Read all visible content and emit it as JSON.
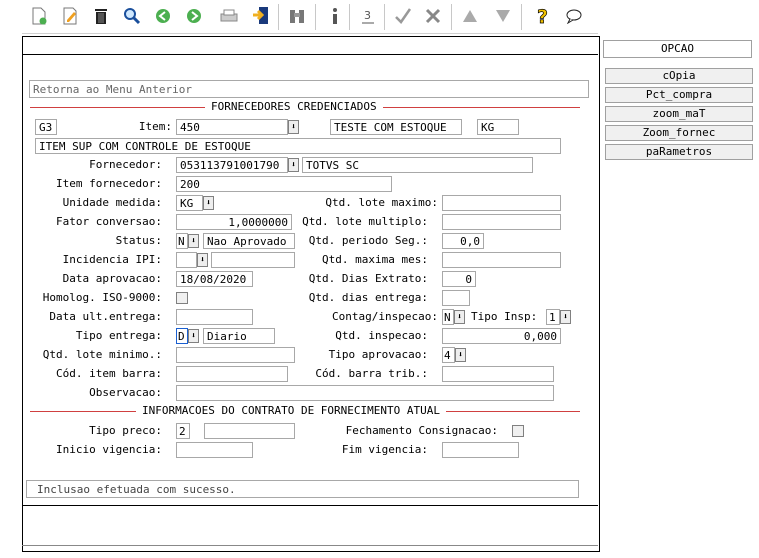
{
  "toolbar": {
    "icons": [
      "new-icon",
      "edit-icon",
      "trash-icon",
      "search-icon",
      "prev-icon",
      "next-icon",
      "print-icon",
      "exit-icon",
      "binoculars-icon",
      "info-icon",
      "sort-icon",
      "check-icon",
      "tools-icon",
      "up-icon",
      "down-icon",
      "help-icon",
      "chat-icon"
    ]
  },
  "side": {
    "opcao": "OPCAO",
    "buttons": [
      "cOpia",
      "Pct_compra",
      "zoom_maT",
      "Zoom_fornec",
      "paRametros"
    ]
  },
  "form": {
    "retorna": "Retorna ao Menu Anterior",
    "section1": "FORNECEDORES CREDENCIADOS",
    "section2": "INFORMACOES DO CONTRATO DE FORNECIMENTO ATUAL",
    "g3": "G3",
    "item_label": "Item:",
    "item_value": "450",
    "item_desc": "TESTE COM ESTOQUE",
    "item_unit": "KG",
    "item_full": "ITEM SUP COM CONTROLE DE ESTOQUE",
    "fornecedor_label": "Fornecedor:",
    "fornecedor_value": "053113791001790",
    "fornecedor_name": "TOTVS SC",
    "item_forn_label": "Item fornecedor:",
    "item_forn_value": "200",
    "unidade_label": "Unidade medida:",
    "unidade_value": "KG",
    "fator_label": "Fator conversao:",
    "fator_value": "1,0000000",
    "status_label": "Status:",
    "status_code": "N",
    "status_desc": "Nao Aprovado",
    "incid_label": "Incidencia IPI:",
    "data_aprov_label": "Data aprovacao:",
    "data_aprov_value": "18/08/2020",
    "homolog_label": "Homolog. ISO-9000:",
    "data_ult_label": "Data ult.entrega:",
    "tipo_entrega_label": "Tipo entrega:",
    "tipo_entrega_code": "D",
    "tipo_entrega_desc": "Diario",
    "qtd_lote_min_label": "Qtd. lote minimo.:",
    "cod_barra_label": "Cód. item barra:",
    "observacao_label": "Observacao:",
    "qtd_lote_max_label": "Qtd. lote maximo:",
    "qtd_lote_mult_label": "Qtd. lote multiplo:",
    "qtd_periodo_label": "Qtd. periodo Seg.:",
    "qtd_periodo_value": "0,0",
    "qtd_max_mes_label": "Qtd. maxima mes:",
    "qtd_dias_extrato_label": "Qtd. Dias Extrato:",
    "qtd_dias_extrato_value": "0",
    "qtd_dias_entrega_label": "Qtd. dias entrega:",
    "contag_label": "Contag/inspecao:",
    "contag_value": "N",
    "tipo_insp_label": "Tipo Insp:",
    "tipo_insp_value": "1",
    "qtd_insp_label": "Qtd. inspecao:",
    "qtd_insp_value": "0,000",
    "tipo_aprov_label": "Tipo aprovacao:",
    "tipo_aprov_value": "4",
    "cod_barra_trib_label": "Cód. barra trib.:",
    "tipo_preco_label": "Tipo preco:",
    "tipo_preco_value": "2",
    "fech_consig_label": "Fechamento Consignacao:",
    "inicio_vig_label": "Inicio vigencia:",
    "fim_vig_label": "Fim vigencia:",
    "status_message": "Inclusao efetuada com sucesso."
  }
}
